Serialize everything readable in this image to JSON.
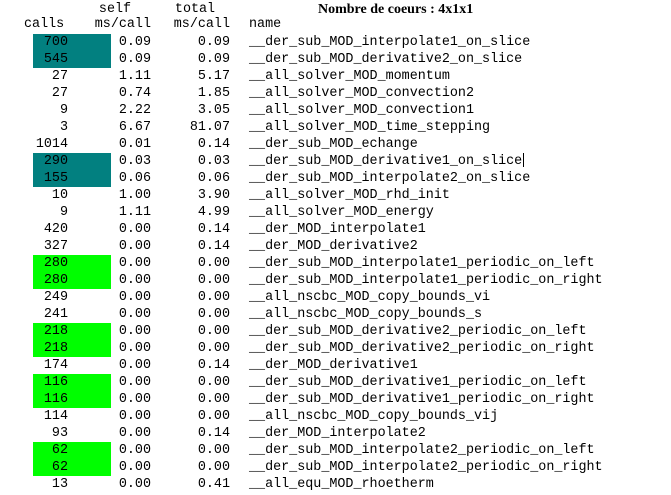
{
  "title": "Nombre de coeurs : 4x1x1",
  "headers": {
    "calls": "calls",
    "self_top": "self",
    "self_bottom": "ms/call",
    "total_top": "total",
    "total_bottom": "ms/call",
    "name": "name"
  },
  "colors": {
    "teal": "#028080",
    "green": "#00fe00"
  },
  "rows": [
    {
      "calls": "700",
      "self": "0.09",
      "total": "0.09",
      "name": "__der_sub_MOD_interpolate1_on_slice",
      "hl": "teal"
    },
    {
      "calls": "545",
      "self": "0.09",
      "total": "0.09",
      "name": "__der_sub_MOD_derivative2_on_slice",
      "hl": "teal"
    },
    {
      "calls": "27",
      "self": "1.11",
      "total": "5.17",
      "name": "__all_solver_MOD_momentum",
      "hl": ""
    },
    {
      "calls": "27",
      "self": "0.74",
      "total": "1.85",
      "name": "__all_solver_MOD_convection2",
      "hl": ""
    },
    {
      "calls": "9",
      "self": "2.22",
      "total": "3.05",
      "name": "__all_solver_MOD_convection1",
      "hl": ""
    },
    {
      "calls": "3",
      "self": "6.67",
      "total": "81.07",
      "name": "__all_solver_MOD_time_stepping",
      "hl": ""
    },
    {
      "calls": "1014",
      "self": "0.01",
      "total": "0.14",
      "name": "__der_sub_MOD_echange",
      "hl": ""
    },
    {
      "calls": "290",
      "self": "0.03",
      "total": "0.03",
      "name": "__der_sub_MOD_derivative1_on_slice",
      "hl": "teal",
      "cursor": true
    },
    {
      "calls": "155",
      "self": "0.06",
      "total": "0.06",
      "name": "__der_sub_MOD_interpolate2_on_slice",
      "hl": "teal"
    },
    {
      "calls": "10",
      "self": "1.00",
      "total": "3.90",
      "name": "__all_solver_MOD_rhd_init",
      "hl": ""
    },
    {
      "calls": "9",
      "self": "1.11",
      "total": "4.99",
      "name": "__all_solver_MOD_energy",
      "hl": ""
    },
    {
      "calls": "420",
      "self": "0.00",
      "total": "0.14",
      "name": "__der_MOD_interpolate1",
      "hl": ""
    },
    {
      "calls": "327",
      "self": "0.00",
      "total": "0.14",
      "name": "__der_MOD_derivative2",
      "hl": ""
    },
    {
      "calls": "280",
      "self": "0.00",
      "total": "0.00",
      "name": "__der_sub_MOD_interpolate1_periodic_on_left",
      "hl": "green"
    },
    {
      "calls": "280",
      "self": "0.00",
      "total": "0.00",
      "name": "__der_sub_MOD_interpolate1_periodic_on_right",
      "hl": "green"
    },
    {
      "calls": "249",
      "self": "0.00",
      "total": "0.00",
      "name": "__all_nscbc_MOD_copy_bounds_vi",
      "hl": ""
    },
    {
      "calls": "241",
      "self": "0.00",
      "total": "0.00",
      "name": "__all_nscbc_MOD_copy_bounds_s",
      "hl": ""
    },
    {
      "calls": "218",
      "self": "0.00",
      "total": "0.00",
      "name": "__der_sub_MOD_derivative2_periodic_on_left",
      "hl": "green"
    },
    {
      "calls": "218",
      "self": "0.00",
      "total": "0.00",
      "name": "__der_sub_MOD_derivative2_periodic_on_right",
      "hl": "green"
    },
    {
      "calls": "174",
      "self": "0.00",
      "total": "0.14",
      "name": "__der_MOD_derivative1",
      "hl": ""
    },
    {
      "calls": "116",
      "self": "0.00",
      "total": "0.00",
      "name": "__der_sub_MOD_derivative1_periodic_on_left",
      "hl": "green"
    },
    {
      "calls": "116",
      "self": "0.00",
      "total": "0.00",
      "name": "__der_sub_MOD_derivative1_periodic_on_right",
      "hl": "green"
    },
    {
      "calls": "114",
      "self": "0.00",
      "total": "0.00",
      "name": "__all_nscbc_MOD_copy_bounds_vij",
      "hl": ""
    },
    {
      "calls": "93",
      "self": "0.00",
      "total": "0.14",
      "name": "__der_MOD_interpolate2",
      "hl": ""
    },
    {
      "calls": "62",
      "self": "0.00",
      "total": "0.00",
      "name": "__der_sub_MOD_interpolate2_periodic_on_left",
      "hl": "green"
    },
    {
      "calls": "62",
      "self": "0.00",
      "total": "0.00",
      "name": "__der_sub_MOD_interpolate2_periodic_on_right",
      "hl": "green"
    },
    {
      "calls": "13",
      "self": "0.00",
      "total": "0.41",
      "name": "__all_equ_MOD_rhoetherm",
      "hl": ""
    }
  ]
}
